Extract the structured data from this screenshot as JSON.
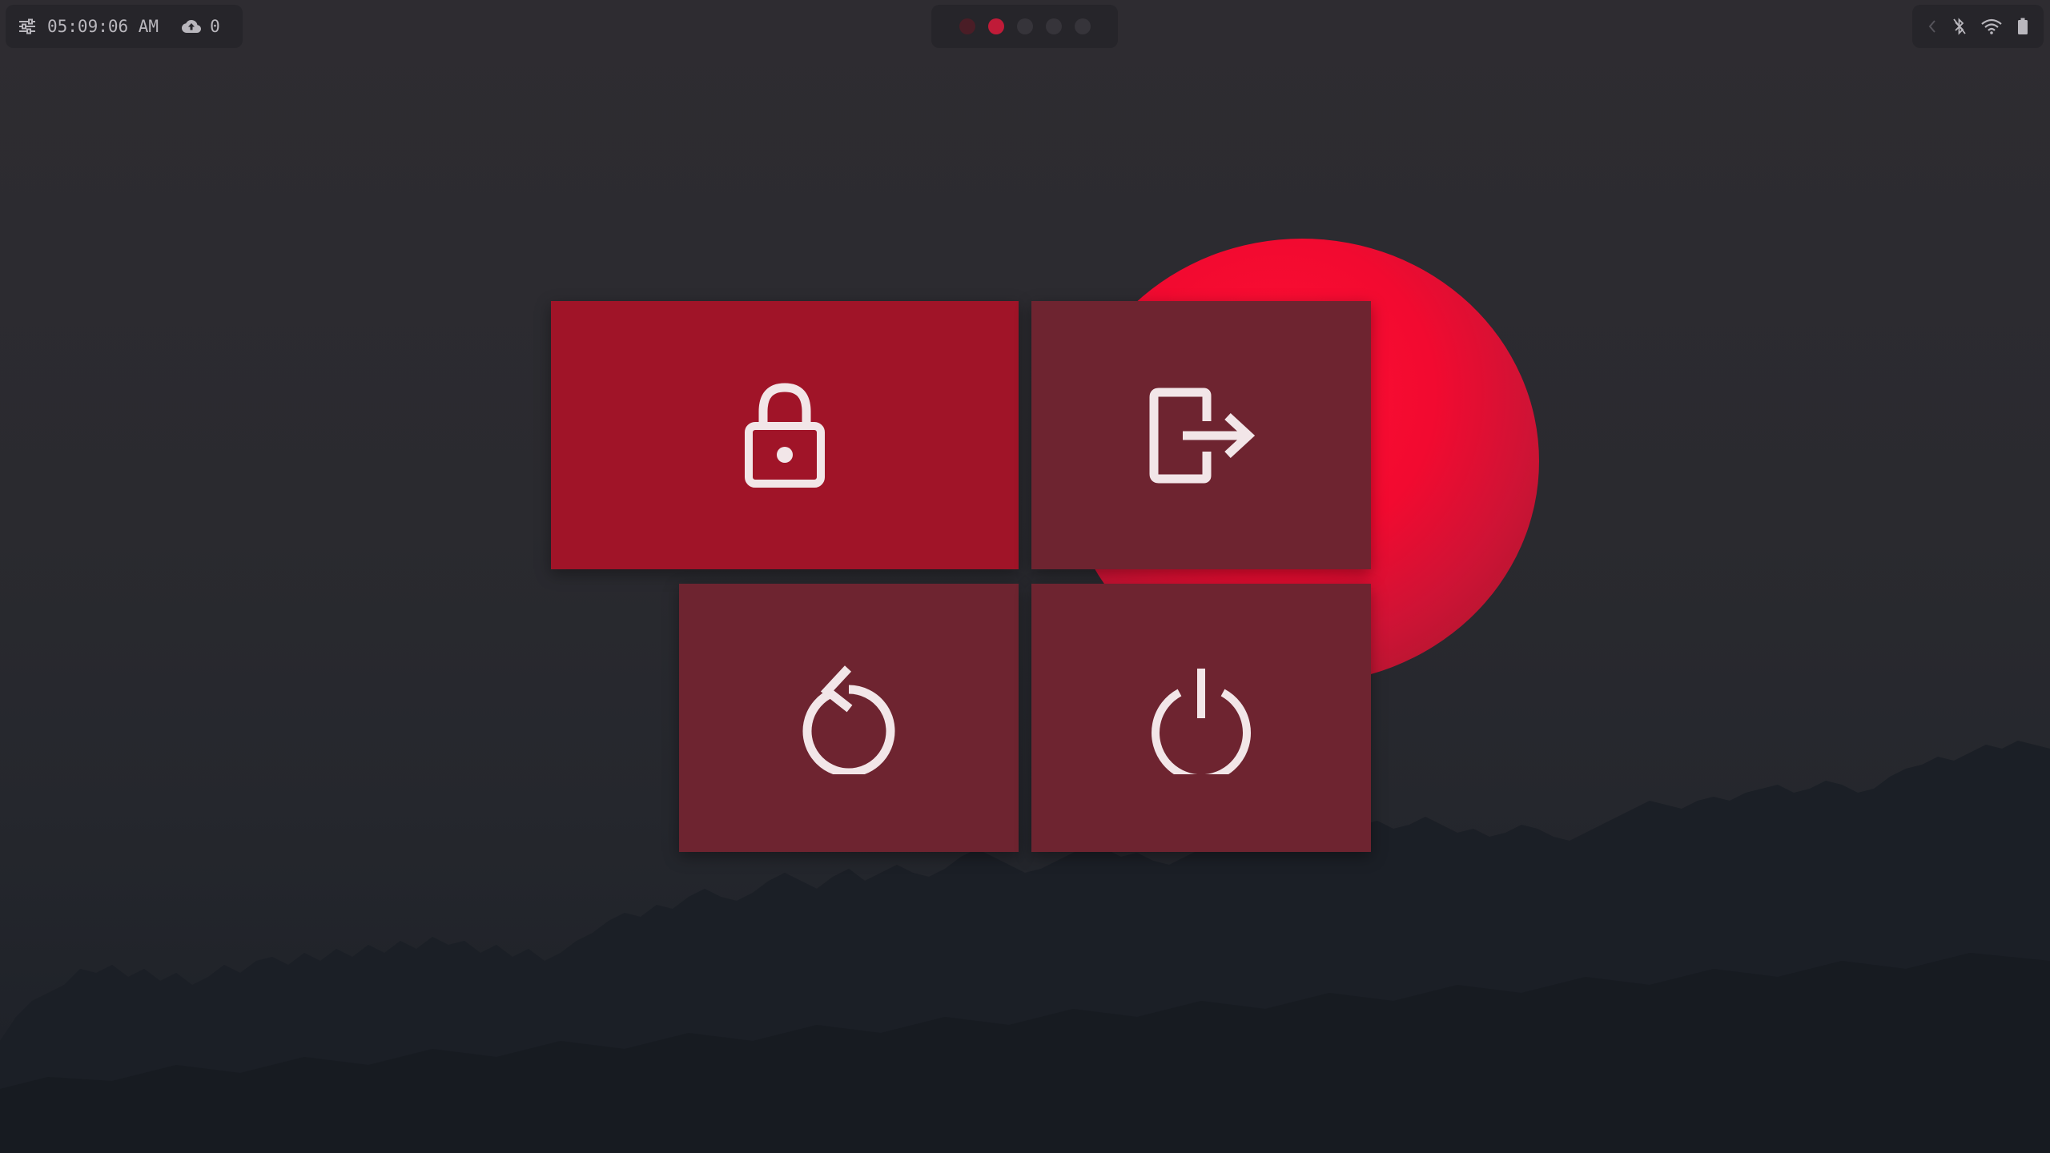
{
  "topbar": {
    "left": {
      "settings_icon": "sliders-icon",
      "clock": "05:09:06 AM",
      "cloud_icon": "cloud-upload-icon",
      "updates_count": "0"
    },
    "workspaces": {
      "count": 5,
      "active_index": 1,
      "dot_colors": [
        "#4a1d26",
        "#c01b38",
        "#36343a",
        "#36343a",
        "#36343a"
      ]
    },
    "right": {
      "icons": [
        "chevron-left-icon",
        "bluetooth-off-icon",
        "wifi-icon",
        "battery-icon"
      ]
    }
  },
  "power_menu": {
    "options": [
      {
        "id": "lock",
        "icon": "lock-icon",
        "active": true
      },
      {
        "id": "logout",
        "icon": "logout-icon",
        "active": false
      },
      {
        "id": "reboot",
        "icon": "reboot-icon",
        "active": false
      },
      {
        "id": "shutdown",
        "icon": "power-icon",
        "active": false
      }
    ],
    "colors": {
      "active": "#a01428",
      "inactive": "#6e2430",
      "icon": "#f2e6e8"
    }
  },
  "wallpaper": {
    "sun_color": "#f20a30",
    "sky_color": "#2c2b30",
    "tree_color": "#1b1f25"
  }
}
